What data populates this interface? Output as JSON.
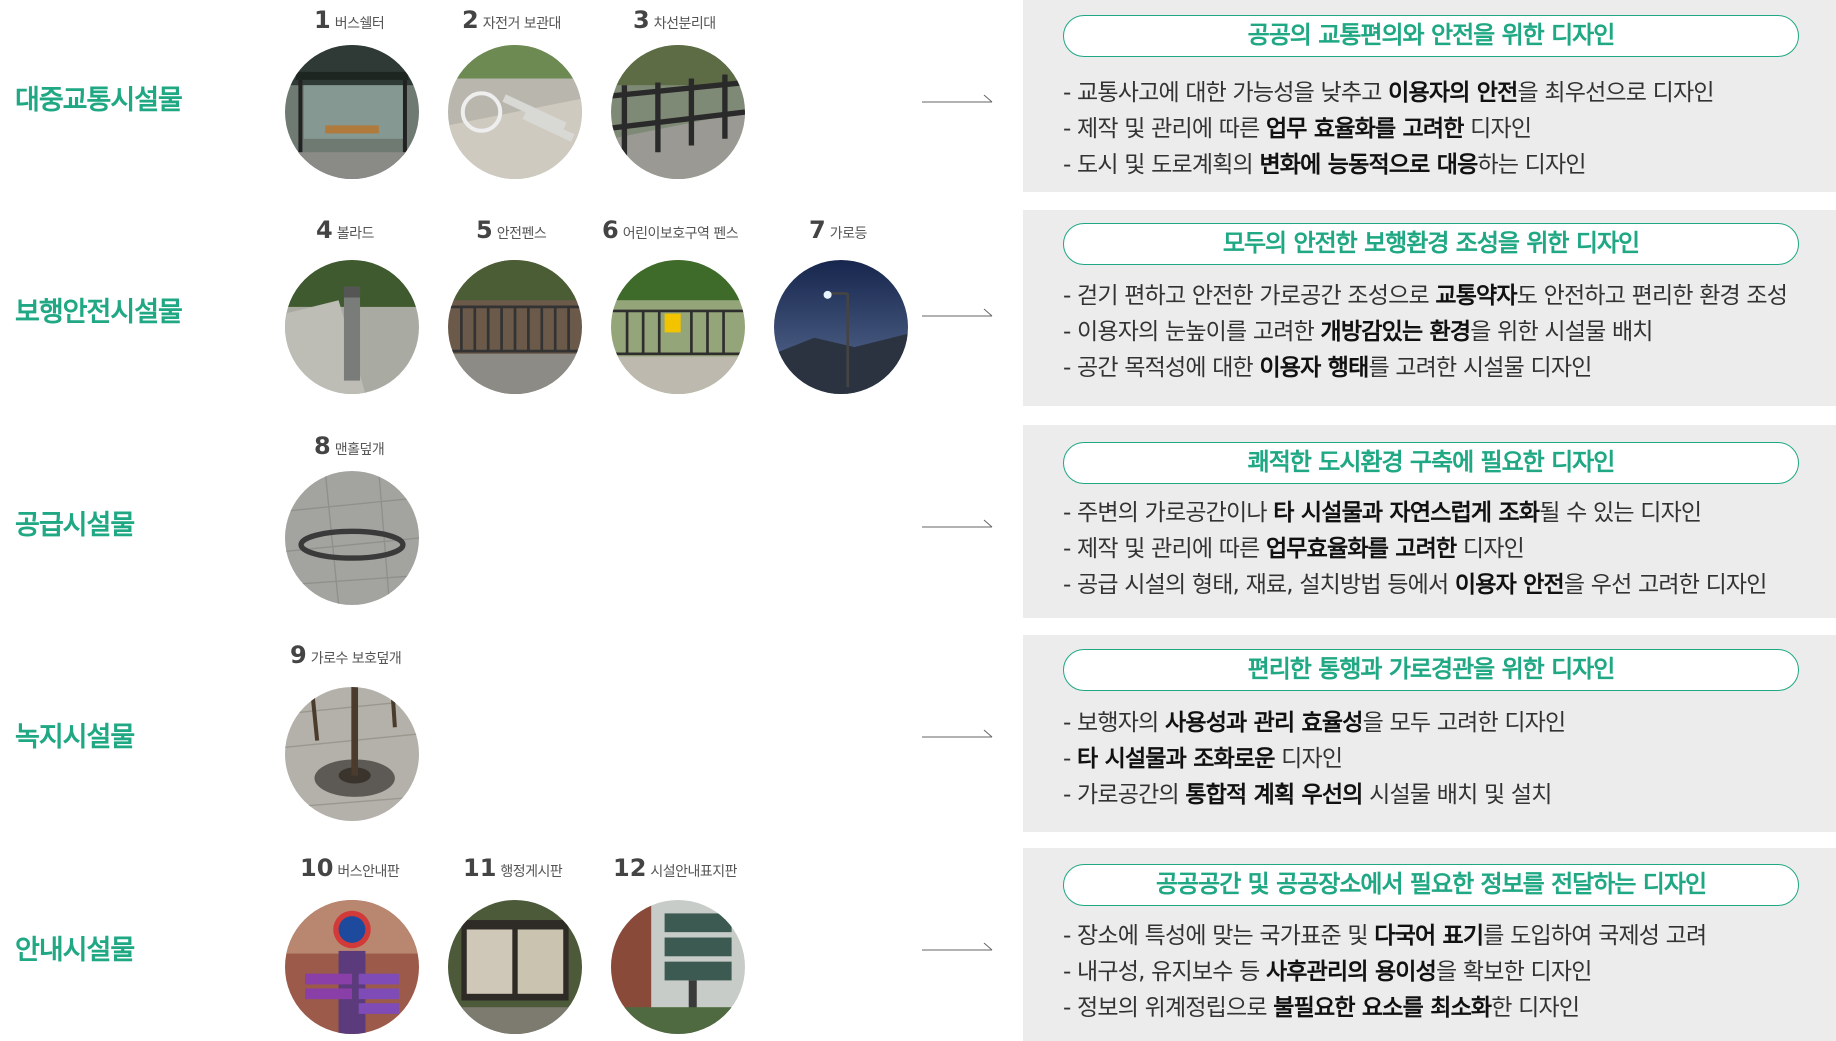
{
  "sections": [
    {
      "category": "대중교통시설물",
      "items": [
        {
          "num": "1",
          "name": "버스쉘터"
        },
        {
          "num": "2",
          "name": "자전거 보관대"
        },
        {
          "num": "3",
          "name": "차선분리대"
        }
      ],
      "title": "공공의 교통편의와 안전을 위한 디자인",
      "bullets": [
        [
          {
            "t": "- 교통사고에 대한 가능성을 낮추고 "
          },
          {
            "t": "이용자의 안전",
            "b": true
          },
          {
            "t": "을 최우선으로 디자인"
          }
        ],
        [
          {
            "t": "- 제작 및 관리에 따른 "
          },
          {
            "t": "업무 효율화를 고려한",
            "b": true
          },
          {
            "t": " 디자인"
          }
        ],
        [
          {
            "t": "- 도시 및 도로계획의 "
          },
          {
            "t": "변화에 능동적으로 대응",
            "b": true
          },
          {
            "t": "하는 디자인"
          }
        ]
      ]
    },
    {
      "category": "보행안전시설물",
      "items": [
        {
          "num": "4",
          "name": "볼라드"
        },
        {
          "num": "5",
          "name": "안전펜스"
        },
        {
          "num": "6",
          "name": "어린이보호구역 펜스"
        },
        {
          "num": "7",
          "name": "가로등"
        }
      ],
      "title": "모두의 안전한 보행환경 조성을 위한 디자인",
      "bullets": [
        [
          {
            "t": "- 걷기 편하고 안전한 가로공간 조성으로 "
          },
          {
            "t": "교통약자",
            "b": true
          },
          {
            "t": "도 안전하고 편리한 환경 조성"
          }
        ],
        [
          {
            "t": "- 이용자의 눈높이를 고려한 "
          },
          {
            "t": "개방감있는 환경",
            "b": true
          },
          {
            "t": "을 위한 시설물 배치"
          }
        ],
        [
          {
            "t": "- 공간 목적성에 대한 "
          },
          {
            "t": "이용자 행태",
            "b": true
          },
          {
            "t": "를 고려한 시설물 디자인"
          }
        ]
      ]
    },
    {
      "category": "공급시설물",
      "items": [
        {
          "num": "8",
          "name": "맨홀덮개"
        }
      ],
      "title": "쾌적한 도시환경 구축에 필요한 디자인",
      "bullets": [
        [
          {
            "t": "- 주변의 가로공간이나 "
          },
          {
            "t": "타 시설물과 자연스럽게 조화",
            "b": true
          },
          {
            "t": "될 수 있는 디자인"
          }
        ],
        [
          {
            "t": "- 제작 및 관리에 따른 "
          },
          {
            "t": "업무효율화를 고려한",
            "b": true
          },
          {
            "t": " 디자인"
          }
        ],
        [
          {
            "t": "- 공급 시설의 형태, 재료, 설치방법 등에서 "
          },
          {
            "t": "이용자 안전",
            "b": true
          },
          {
            "t": "을 우선 고려한 디자인"
          }
        ]
      ]
    },
    {
      "category": "녹지시설물",
      "items": [
        {
          "num": "9",
          "name": "가로수 보호덮개"
        }
      ],
      "title": "편리한 통행과 가로경관을 위한 디자인",
      "bullets": [
        [
          {
            "t": "- 보행자의 "
          },
          {
            "t": "사용성과 관리 효율성",
            "b": true
          },
          {
            "t": "을 모두 고려한 디자인"
          }
        ],
        [
          {
            "t": "- "
          },
          {
            "t": "타 시설물과 조화로운",
            "b": true
          },
          {
            "t": " 디자인"
          }
        ],
        [
          {
            "t": "- 가로공간의 "
          },
          {
            "t": "통합적 계획 우선의",
            "b": true
          },
          {
            "t": " 시설물 배치 및 설치"
          }
        ]
      ]
    },
    {
      "category": "안내시설물",
      "items": [
        {
          "num": "10",
          "name": "버스안내판"
        },
        {
          "num": "11",
          "name": "행정게시판"
        },
        {
          "num": "12",
          "name": "시설안내표지판"
        }
      ],
      "title": "공공공간 및 공공장소에서 필요한 정보를 전달하는 디자인",
      "bullets": [
        [
          {
            "t": "- 장소에 특성에 맞는 국가표준 및 "
          },
          {
            "t": "다국어 표기",
            "b": true
          },
          {
            "t": "를 도입하여 국제성 고려"
          }
        ],
        [
          {
            "t": "- 내구성, 유지보수 등 "
          },
          {
            "t": "사후관리의 용이성",
            "b": true
          },
          {
            "t": "을 확보한 디자인"
          }
        ],
        [
          {
            "t": "- 정보의 위계정립으로 "
          },
          {
            "t": "불필요한 요소를 최소화",
            "b": true
          },
          {
            "t": "한 디자인"
          }
        ]
      ]
    }
  ],
  "colors": {
    "accent": "#1fa883",
    "panel": "#ececec",
    "text": "#333333"
  },
  "icons": [
    "arrow-icon",
    "bus-shelter-photo",
    "bicycle-rack-photo",
    "lane-divider-photo",
    "bollard-photo",
    "safety-fence-photo",
    "school-zone-fence-photo",
    "streetlight-photo",
    "manhole-cover-photo",
    "tree-grate-photo",
    "bus-sign-photo",
    "notice-board-photo",
    "facility-sign-photo"
  ]
}
